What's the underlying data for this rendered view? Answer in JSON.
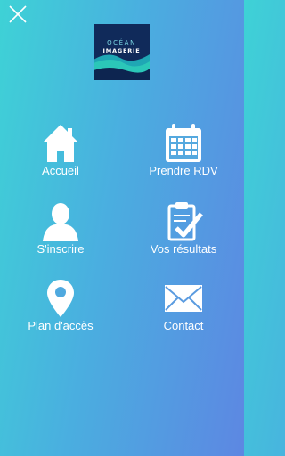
{
  "close": {
    "icon": "close-icon"
  },
  "logo": {
    "line1": "OCÉAN",
    "line2": "IMAGERIE"
  },
  "menu": [
    {
      "label": "Accueil",
      "icon": "home-icon"
    },
    {
      "label": "Prendre RDV",
      "icon": "calendar-icon"
    },
    {
      "label": "S'inscrire",
      "icon": "user-icon"
    },
    {
      "label": "Vos résultats",
      "icon": "clipboard-check-icon"
    },
    {
      "label": "Plan d'accès",
      "icon": "map-pin-icon"
    },
    {
      "label": "Contact",
      "icon": "envelope-icon"
    }
  ],
  "colors": {
    "gradient_start": "#3ed2d6",
    "gradient_end": "#5d87e2",
    "icon": "#ffffff"
  }
}
